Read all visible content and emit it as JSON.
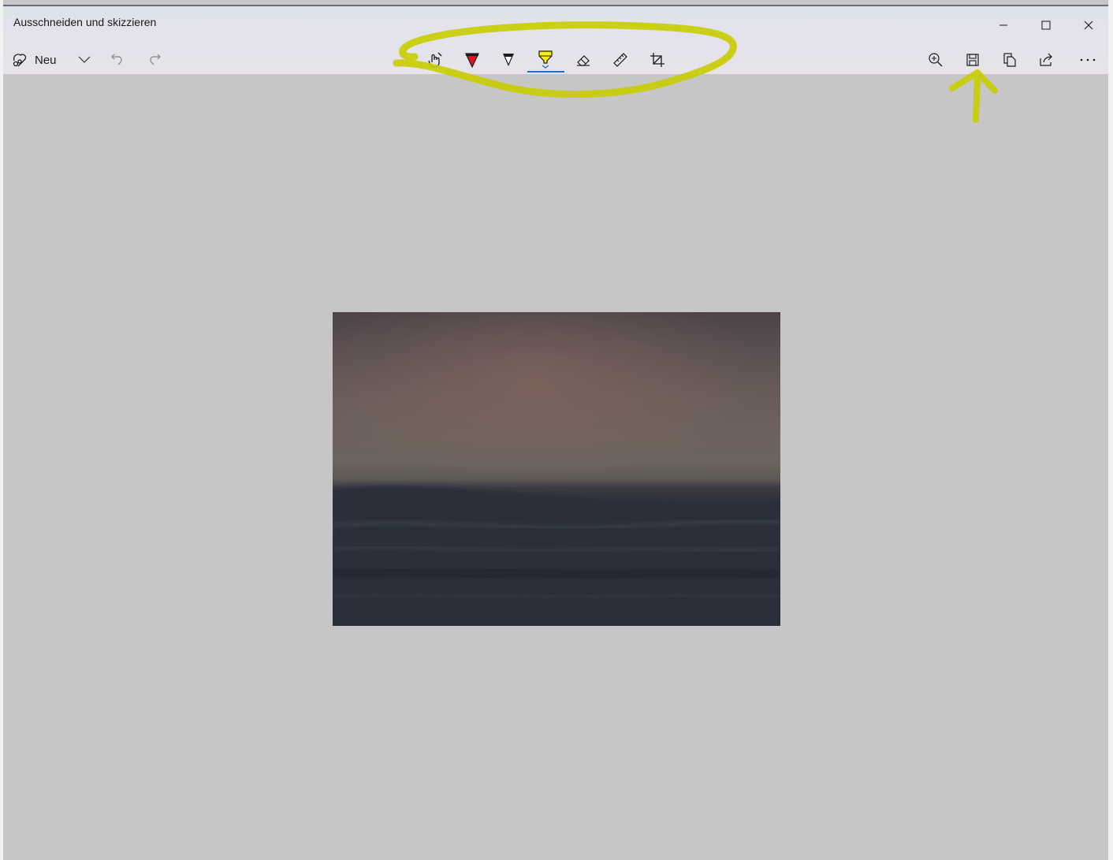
{
  "window": {
    "title": "Ausschneiden und skizzieren",
    "minimize_icon": "minimize-icon",
    "maximize_icon": "maximize-icon",
    "close_icon": "close-icon"
  },
  "toolbar": {
    "new_label": "Neu",
    "tools": [
      {
        "name": "touch-writing",
        "icon": "touch-writing-icon"
      },
      {
        "name": "ballpoint-pen",
        "icon": "pen-icon",
        "color": "#e81123"
      },
      {
        "name": "pencil",
        "icon": "pencil-icon",
        "color": "#1a1a1a"
      },
      {
        "name": "highlighter",
        "icon": "highlighter-icon",
        "color": "#fff100",
        "selected": true
      },
      {
        "name": "eraser",
        "icon": "eraser-icon"
      },
      {
        "name": "ruler",
        "icon": "ruler-icon"
      },
      {
        "name": "crop",
        "icon": "crop-icon"
      }
    ],
    "right_actions": [
      "zoom-in-icon",
      "save-icon",
      "copy-icon",
      "share-icon",
      "more-icon"
    ]
  },
  "colors": {
    "accent": "#1f6fd1",
    "annotation": "#c8cc00",
    "canvas": "#c6c6c6"
  },
  "annotations": {
    "highlight_ellipse": "toolbar-tools",
    "arrow_target": "save-button"
  }
}
